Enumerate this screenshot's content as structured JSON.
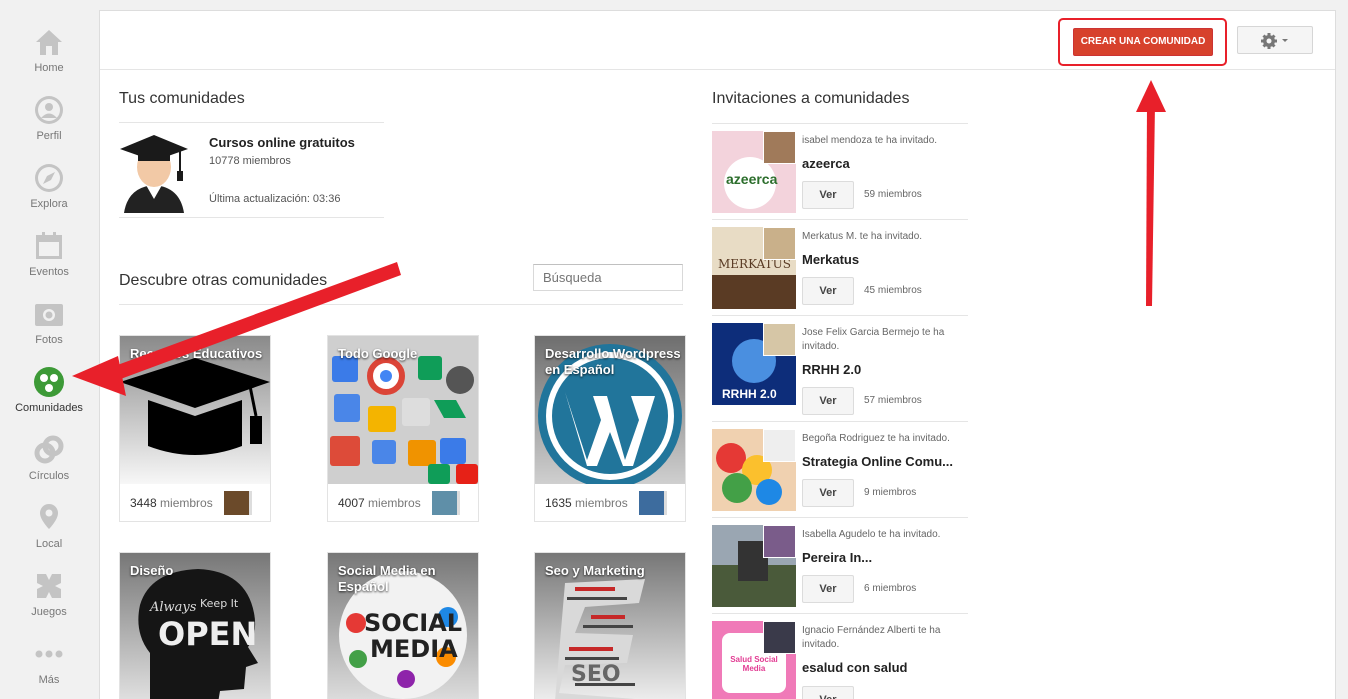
{
  "nav": {
    "home": "Home",
    "profile": "Perfil",
    "explore": "Explora",
    "events": "Eventos",
    "photos": "Fotos",
    "communities": "Comunidades",
    "circles": "Círculos",
    "local": "Local",
    "games": "Juegos",
    "more": "Más"
  },
  "header": {
    "create_label": "CREAR UNA COMUNIDAD",
    "create_color": "#d7412c",
    "highlight_color": "#e8202a"
  },
  "my_communities": {
    "title": "Tus comunidades",
    "name": "Cursos online gratuitos",
    "members": "10778 miembros",
    "updated": "Última actualización: 03:36"
  },
  "discover": {
    "title": "Descubre otras comunidades",
    "search_placeholder": "Búsqueda",
    "member_label": "miembros",
    "tiles": [
      {
        "title": "Recursos Educativos",
        "count": "3448"
      },
      {
        "title": "Todo Google",
        "count": "4007"
      },
      {
        "title": "Desarrollo Wordpress en Español",
        "count": "1635"
      },
      {
        "title": "Diseño",
        "count": ""
      },
      {
        "title": "Social Media en Español",
        "count": ""
      },
      {
        "title": "Seo y Marketing",
        "count": ""
      }
    ],
    "image_words": {
      "always": "Always",
      "keep_it": "Keep It",
      "open": "OPEN",
      "social": "SOCIAL",
      "media": "MEDIA",
      "seo": "SEO"
    }
  },
  "invitations": {
    "title": "Invitaciones a comunidades",
    "view_label": "Ver",
    "items": [
      {
        "who": "isabel mendoza te ha invitado.",
        "name": "azeerca",
        "members": "59 miembros",
        "logo": "azeerca"
      },
      {
        "who": "Merkatus M. te ha invitado.",
        "name": "Merkatus",
        "members": "45 miembros",
        "logo": "MERKATUS"
      },
      {
        "who": "Jose Felix Garcia Bermejo te ha invitado.",
        "name": "RRHH 2.0",
        "members": "57 miembros",
        "logo": "RRHH 2.0"
      },
      {
        "who": "Begoña Rodriguez te ha invitado.",
        "name": "Strategia Online Comu...",
        "members": "9 miembros",
        "logo": ""
      },
      {
        "who": "Isabella Agudelo te ha invitado.",
        "name": "Pereira In...",
        "members": "6 miembros",
        "logo": ""
      },
      {
        "who": "Ignacio Fernández Alberti te ha invitado.",
        "name": "esalud con salud",
        "members": "",
        "logo": "Salud Social Media"
      }
    ]
  }
}
